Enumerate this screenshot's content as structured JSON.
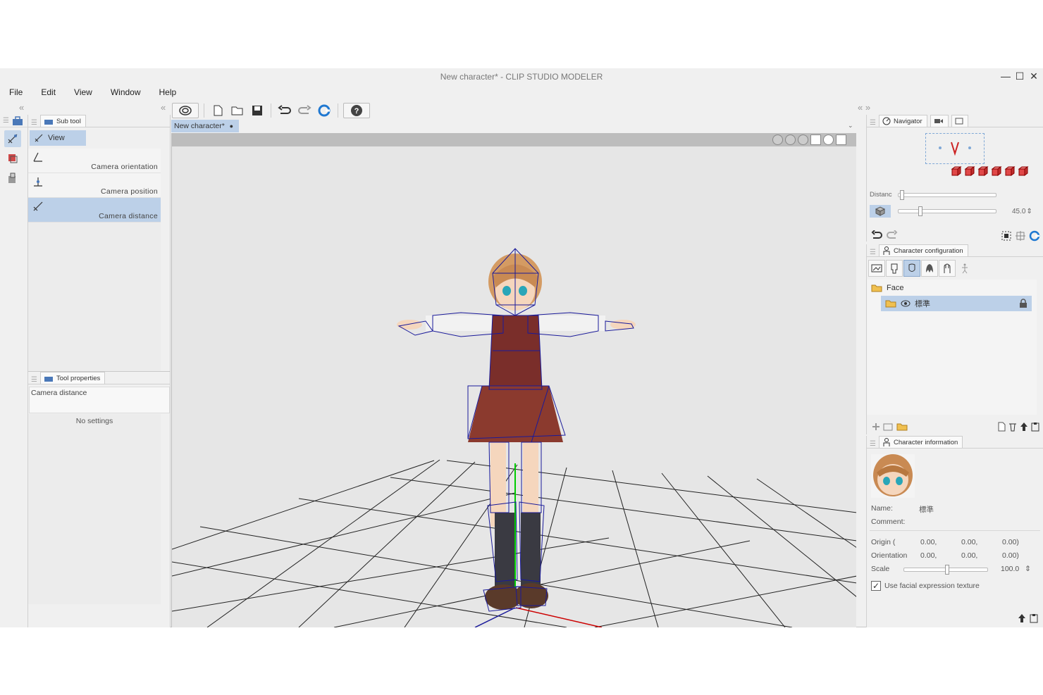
{
  "window": {
    "title": "New character* - CLIP STUDIO MODELER",
    "controls": {
      "minimize": "—",
      "maximize": "☐",
      "close": "✕"
    }
  },
  "menu": {
    "items": [
      "File",
      "Edit",
      "View",
      "Window",
      "Help"
    ]
  },
  "panels": {
    "collapse_left": "«",
    "collapse_right": "«  »"
  },
  "subtool": {
    "tab_label": "Sub tool",
    "group_label": "View",
    "items": [
      {
        "label": "Camera orientation",
        "icon": "camera-orientation-icon"
      },
      {
        "label": "Camera position",
        "icon": "camera-position-icon"
      },
      {
        "label": "Camera distance",
        "icon": "camera-distance-icon",
        "selected": true
      }
    ]
  },
  "tool_properties": {
    "tab_label": "Tool properties",
    "tool_name": "Camera distance",
    "empty_text": "No settings"
  },
  "toolbar": {
    "buttons": [
      "spiral-icon",
      "new-file-icon",
      "open-folder-icon",
      "save-icon",
      "undo-icon",
      "redo-icon",
      "refresh-icon",
      "help-icon"
    ]
  },
  "document": {
    "tab_label": "New character*",
    "modified_dot": "●",
    "menu_arrow": "⌄"
  },
  "navigator": {
    "tab_label": "Navigator",
    "distance_label": "Distanc",
    "fov_value": "45.0",
    "spin_icon": "⇕"
  },
  "character_configuration": {
    "tab_label": "Character configuration",
    "tree": {
      "folder_label": "Face",
      "item_label": "標準"
    }
  },
  "character_information": {
    "tab_label": "Character information",
    "name_label": "Name:",
    "name_value": "標準",
    "comment_label": "Comment:",
    "origin_label": "Origin (",
    "origin_values": [
      "0.00,",
      "0.00,",
      "0.00)"
    ],
    "orientation_label": "Orientation",
    "orientation_values": [
      "0.00,",
      "0.00,",
      "0.00)"
    ],
    "scale_label": "Scale",
    "scale_value": "100.0",
    "facial_texture_label": "Use facial expression texture",
    "facial_texture_checked": "✓"
  },
  "colors": {
    "selection": "#bcd0e8",
    "panel_bg": "#f0f0f0",
    "viewport_bg": "#e6e6e6",
    "wireframe": "#1a1a9a",
    "axis_red": "#cc0000",
    "axis_green": "#00cc00"
  }
}
